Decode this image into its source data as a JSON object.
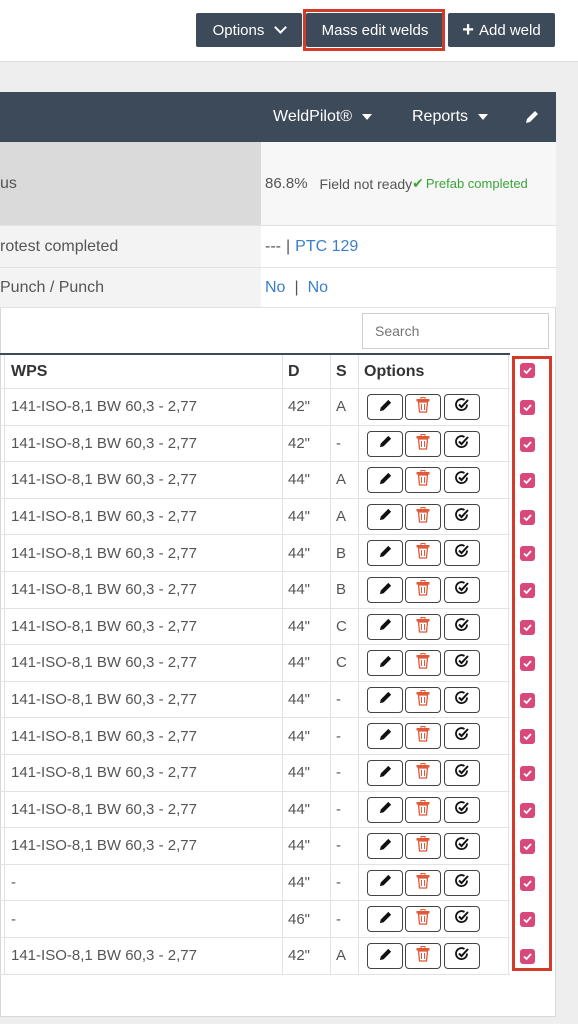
{
  "toolbar": {
    "options_label": "Options",
    "mass_edit_label": "Mass edit welds",
    "add_weld_label": "Add weld"
  },
  "nav": {
    "weldpilot_label": "WeldPilot®",
    "reports_label": "Reports"
  },
  "info": {
    "status_label": "us",
    "status_percent": "86.8%",
    "status_field": "Field not ready",
    "status_prefab": "Prefab completed",
    "protest_label": "rotest completed",
    "protest_value": "---",
    "protest_sep": "|",
    "protest_link": "PTC 129",
    "punch_label": "Punch / Punch",
    "punch_value_1": "No",
    "punch_sep": "|",
    "punch_value_2": "No"
  },
  "search": {
    "placeholder": "Search"
  },
  "table": {
    "headers": {
      "wps": "WPS",
      "d": "D",
      "s": "S",
      "options": "Options"
    },
    "rows": [
      {
        "wps": "141-ISO-8,1 BW 60,3 - 2,77",
        "d": "42\"",
        "s": "A"
      },
      {
        "wps": "141-ISO-8,1 BW 60,3 - 2,77",
        "d": "42\"",
        "s": "-"
      },
      {
        "wps": "141-ISO-8,1 BW 60,3 - 2,77",
        "d": "44\"",
        "s": "A"
      },
      {
        "wps": "141-ISO-8,1 BW 60,3 - 2,77",
        "d": "44\"",
        "s": "A"
      },
      {
        "wps": "141-ISO-8,1 BW 60,3 - 2,77",
        "d": "44\"",
        "s": "B"
      },
      {
        "wps": "141-ISO-8,1 BW 60,3 - 2,77",
        "d": "44\"",
        "s": "B"
      },
      {
        "wps": "141-ISO-8,1 BW 60,3 - 2,77",
        "d": "44\"",
        "s": "C"
      },
      {
        "wps": "141-ISO-8,1 BW 60,3 - 2,77",
        "d": "44\"",
        "s": "C"
      },
      {
        "wps": "141-ISO-8,1 BW 60,3 - 2,77",
        "d": "44\"",
        "s": "-"
      },
      {
        "wps": "141-ISO-8,1 BW 60,3 - 2,77",
        "d": "44\"",
        "s": "-"
      },
      {
        "wps": "141-ISO-8,1 BW 60,3 - 2,77",
        "d": "44\"",
        "s": "-"
      },
      {
        "wps": "141-ISO-8,1 BW 60,3 - 2,77",
        "d": "44\"",
        "s": "-"
      },
      {
        "wps": "141-ISO-8,1 BW 60,3 - 2,77",
        "d": "44\"",
        "s": "-"
      },
      {
        "wps": "-",
        "d": "44\"",
        "s": "-"
      },
      {
        "wps": "-",
        "d": "46\"",
        "s": "-"
      },
      {
        "wps": "141-ISO-8,1 BW 60,3 - 2,77",
        "d": "42\"",
        "s": "A"
      }
    ]
  },
  "colors": {
    "dark_header": "#3d4a5a",
    "highlight_red": "#d23a2a",
    "checkbox_pink": "#d9487a",
    "link_blue": "#3b7fc9",
    "success_green": "#3aa53a"
  }
}
